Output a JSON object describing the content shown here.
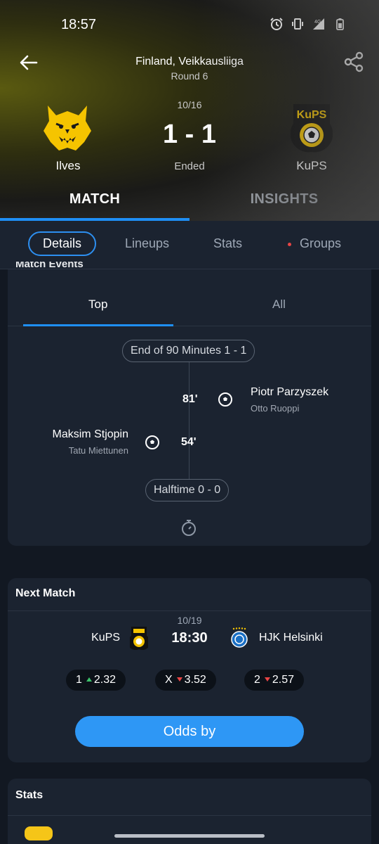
{
  "status_bar": {
    "time": "18:57",
    "network": "4G"
  },
  "header": {
    "league": "Finland, Veikkausliiga",
    "round": "Round 6",
    "date": "10/16",
    "score": "1 - 1",
    "status": "Ended",
    "home_team": "Ilves",
    "away_team": "KuPS",
    "away_logo_text": "KuPS",
    "accent": "#1f8ff5"
  },
  "main_tabs": {
    "match": "MATCH",
    "insights": "INSIGHTS"
  },
  "sub_tabs": {
    "details": "Details",
    "lineups": "Lineups",
    "stats": "Stats",
    "groups": "Groups"
  },
  "match_events": {
    "title": "Match Events",
    "tabs": {
      "top": "Top",
      "all": "All"
    },
    "end_pill": "End of 90 Minutes 1 - 1",
    "halftime_pill": "Halftime 0 - 0",
    "events": [
      {
        "minute": "81'",
        "player": "Piotr Parzyszek",
        "assist": "Otto Ruoppi",
        "side": "away"
      },
      {
        "minute": "54'",
        "player": "Maksim Stjopin",
        "assist": "Tatu Miettunen",
        "side": "home"
      }
    ]
  },
  "next_match": {
    "title": "Next Match",
    "date": "10/19",
    "time": "18:30",
    "home": "KuPS",
    "away": "HJK Helsinki",
    "odds": [
      {
        "label": "1",
        "value": "2.32",
        "trend": "up"
      },
      {
        "label": "X",
        "value": "3.52",
        "trend": "down"
      },
      {
        "label": "2",
        "value": "2.57",
        "trend": "down"
      }
    ],
    "button": "Odds by"
  },
  "stats_card": {
    "title": "Stats"
  }
}
